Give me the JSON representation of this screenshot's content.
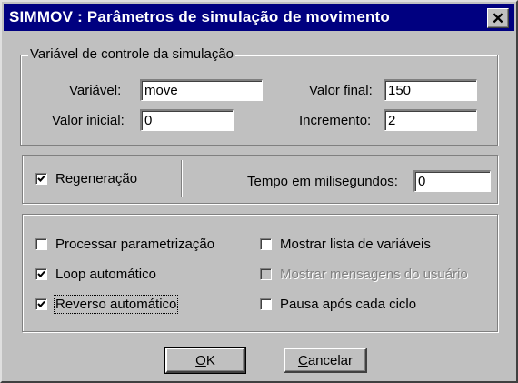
{
  "window": {
    "title": "SIMMOV : Parâmetros de simulação de movimento",
    "close_glyph": "✕"
  },
  "control_group": {
    "legend": "Variável de controle da simulação",
    "variavel": {
      "label": "Variável:",
      "value": "move"
    },
    "valor_final": {
      "label": "Valor final:",
      "value": "150"
    },
    "valor_inicial": {
      "label": "Valor inicial:",
      "value": "0"
    },
    "incremento": {
      "label": "Incremento:",
      "value": "2"
    }
  },
  "regen_group": {
    "regeneracao": {
      "label": "Regeneração",
      "checked": true
    },
    "tempo": {
      "label": "Tempo em milisegundos:",
      "value": "0"
    }
  },
  "options": {
    "processar": {
      "label": "Processar parametrização",
      "checked": false
    },
    "loop": {
      "label": "Loop automático",
      "checked": true
    },
    "reverso": {
      "label": "Reverso automático",
      "checked": true
    },
    "mostrar_lista": {
      "label": "Mostrar lista de variáveis",
      "checked": false
    },
    "mostrar_mensagens": {
      "label": "Mostrar mensagens do usuário",
      "checked": false,
      "disabled": true
    },
    "pausa": {
      "label": "Pausa após cada ciclo",
      "checked": false
    }
  },
  "buttons": {
    "ok": {
      "label_underlined": "O",
      "label_rest": "K"
    },
    "cancel": {
      "label_underlined": "C",
      "label_rest": "ancelar"
    }
  },
  "colors": {
    "titlebar": "#000080",
    "face": "#c0c0c0"
  }
}
